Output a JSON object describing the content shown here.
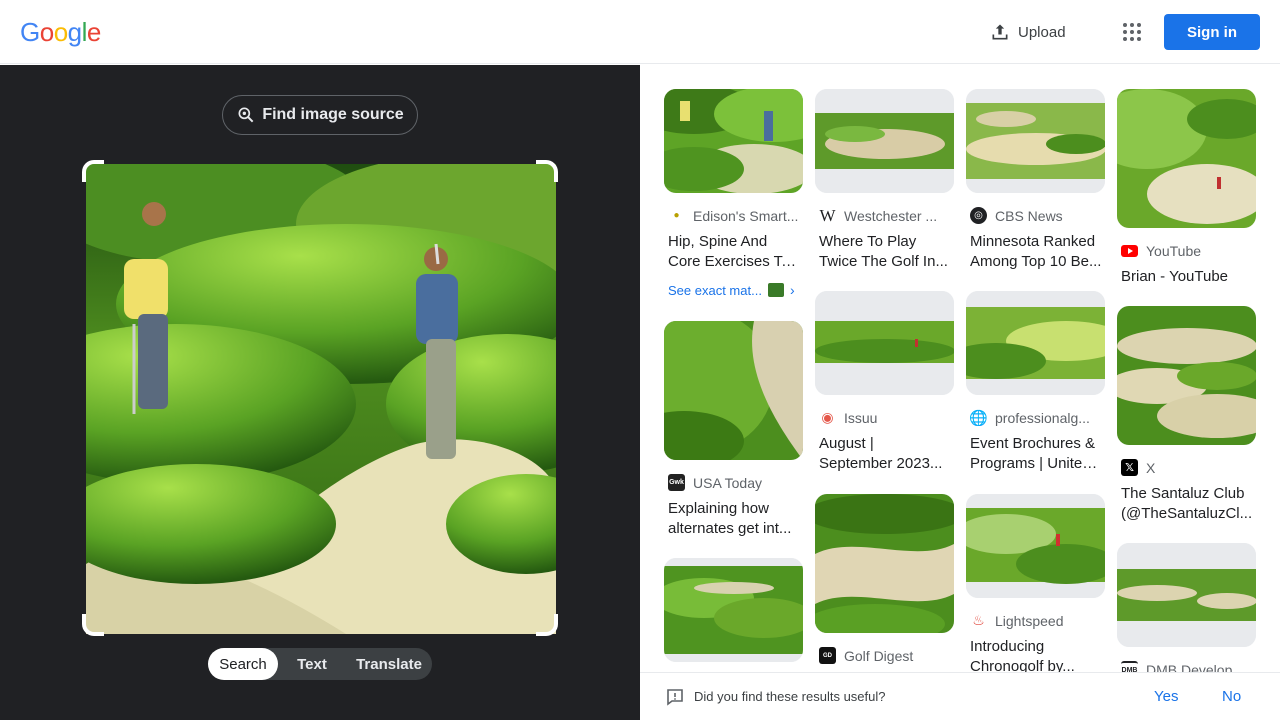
{
  "header": {
    "logo": [
      "G",
      "o",
      "o",
      "g",
      "l",
      "e"
    ],
    "logo_colors": [
      "#4285F4",
      "#EA4335",
      "#FBBC05",
      "#4285F4",
      "#34A853",
      "#EA4335"
    ],
    "upload_label": "Upload",
    "signin_label": "Sign in"
  },
  "left": {
    "find_source_label": "Find image source",
    "tabs": [
      {
        "label": "Search",
        "active": true
      },
      {
        "label": "Text",
        "active": false
      },
      {
        "label": "Translate",
        "active": false
      }
    ]
  },
  "results": {
    "col1": [
      {
        "source": "Edison's Smart...",
        "favicon": "pin-icon",
        "title": [
          "Hip, Spine And",
          "Core Exercises To..."
        ],
        "exact_label": "See exact mat..."
      },
      {
        "source": "USA Today",
        "favicon": "gwk-icon",
        "title": [
          "Explaining how",
          "alternates get int..."
        ]
      },
      {
        "source": "",
        "title": []
      }
    ],
    "col2": [
      {
        "source": "Westchester ...",
        "favicon": "w-icon",
        "title": [
          "Where To Play",
          "Twice The Golf In..."
        ]
      },
      {
        "source": "Issuu",
        "favicon": "issuu-icon",
        "title": [
          "August |",
          "September 2023..."
        ]
      },
      {
        "source": "Golf Digest",
        "favicon": "golfdigest-icon",
        "title": []
      }
    ],
    "col3": [
      {
        "source": "CBS News",
        "favicon": "cbs-icon",
        "title": [
          "Minnesota Ranked",
          "Among Top 10 Be..."
        ]
      },
      {
        "source": "professionalg...",
        "favicon": "globe-icon",
        "title": [
          "Event Brochures &",
          "Programs | United..."
        ]
      },
      {
        "source": "Lightspeed",
        "favicon": "flame-icon",
        "title": [
          "Introducing",
          "Chronogolf by..."
        ]
      }
    ],
    "col4": [
      {
        "source": "YouTube",
        "favicon": "youtube-icon",
        "title": [
          "Brian - YouTube"
        ]
      },
      {
        "source": "X",
        "favicon": "x-icon",
        "title": [
          "The Santaluz Club",
          "(@TheSantaluzCl..."
        ]
      },
      {
        "source": "DMB Develop...",
        "favicon": "dmb-icon",
        "title": []
      }
    ]
  },
  "feedback": {
    "question": "Did you find these results useful?",
    "yes_label": "Yes",
    "no_label": "No"
  }
}
